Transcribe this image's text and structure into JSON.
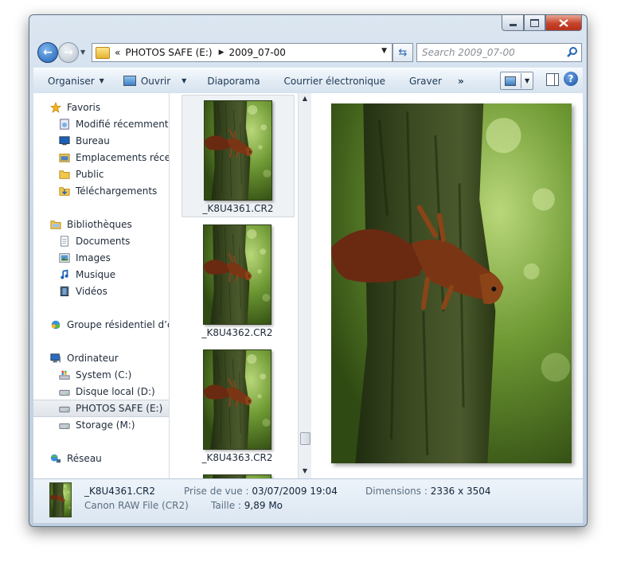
{
  "window": {
    "address": {
      "prefix": "«",
      "segments": [
        "PHOTOS SAFE (E:)",
        "2009_07-00"
      ]
    },
    "search_placeholder": "Search 2009_07-00"
  },
  "toolbar": {
    "organize": "Organiser",
    "open": "Ouvrir",
    "slideshow": "Diaporama",
    "email": "Courrier électronique",
    "burn": "Graver",
    "more": "»"
  },
  "nav": {
    "favorites": {
      "label": "Favoris",
      "items": [
        "Modifié récemment",
        "Bureau",
        "Emplacements récents",
        "Public",
        "Téléchargements"
      ]
    },
    "libraries": {
      "label": "Bibliothèques",
      "items": [
        "Documents",
        "Images",
        "Musique",
        "Vidéos"
      ]
    },
    "homegroup": "Groupe résidentiel d’ordinateurs",
    "computer": {
      "label": "Ordinateur",
      "items": [
        "System (C:)",
        "Disque local (D:)",
        "PHOTOS SAFE (E:)",
        "Storage (M:)"
      ]
    },
    "network": "Réseau"
  },
  "files": [
    {
      "name": "_K8U4361.CR2",
      "selected": true
    },
    {
      "name": "_K8U4362.CR2",
      "selected": false
    },
    {
      "name": "_K8U4363.CR2",
      "selected": false
    }
  ],
  "details": {
    "name": "_K8U4361.CR2",
    "type": "Canon RAW File (CR2)",
    "date_label": "Prise de vue :",
    "date_value": "03/07/2009 19:04",
    "size_label": "Taille :",
    "size_value": "9,89 Mo",
    "dim_label": "Dimensions :",
    "dim_value": "2336 x 3504"
  },
  "colors": {
    "selection": "#dfe4ea",
    "toolbar_text": "#1e3954",
    "close_button": "#c7432b"
  }
}
